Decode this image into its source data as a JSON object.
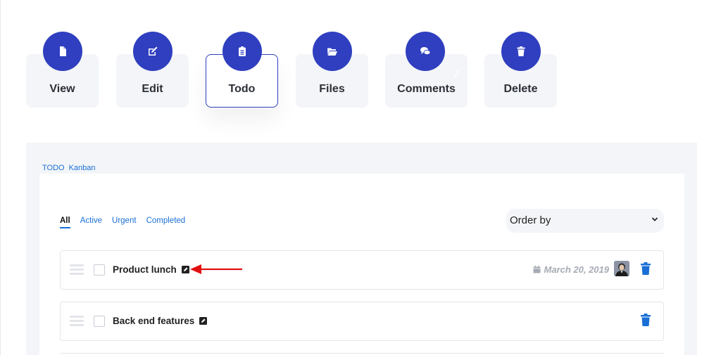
{
  "actions": [
    {
      "label": "View",
      "icon": "file-icon"
    },
    {
      "label": "Edit",
      "icon": "edit-icon"
    },
    {
      "label": "Todo",
      "icon": "clipboard-icon",
      "active": true
    },
    {
      "label": "Files",
      "icon": "folder-open-icon"
    },
    {
      "label": "Comments",
      "icon": "comments-icon",
      "badge": "2"
    },
    {
      "label": "Delete",
      "icon": "trash-icon"
    }
  ],
  "panel": {
    "tabs": [
      "TODO",
      "Kanban"
    ],
    "filters": [
      "All",
      "Active",
      "Urgent",
      "Completed"
    ],
    "selected_filter": "All",
    "order_by": "Order by"
  },
  "todos": [
    {
      "title": "Product lunch",
      "date": "March 20, 2019",
      "has_avatar": true
    },
    {
      "title": "Back end features",
      "date": "",
      "has_avatar": false
    }
  ],
  "colors": {
    "accent": "#2f3fbf",
    "link": "#1a6fd6",
    "annotation": "#e01010"
  }
}
